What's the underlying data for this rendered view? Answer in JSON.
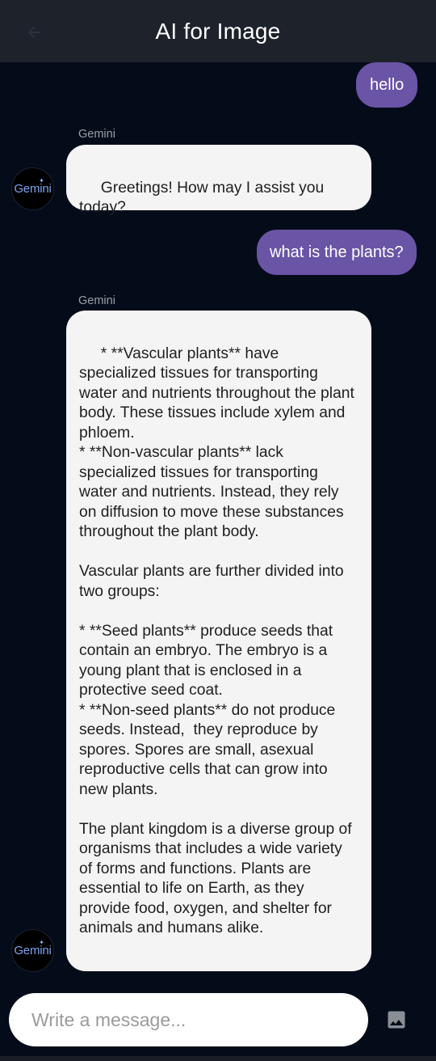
{
  "app": {
    "title": "AI for Image",
    "back_icon": "arrow-back-icon"
  },
  "messages": [
    {
      "role": "user",
      "text": "hello"
    },
    {
      "role": "ai",
      "sender": "Gemini",
      "avatar_label": "Gemini",
      "text": " Greetings! How may I assist you today?"
    },
    {
      "role": "user",
      "text": "what is the plants?"
    },
    {
      "role": "ai",
      "sender": "Gemini",
      "avatar_label": "Gemini",
      "text": " * **Vascular plants** have specialized tissues for transporting water and nutrients throughout the plant  body. These tissues include xylem and phloem.\n* **Non-vascular plants** lack specialized tissues for transporting water and nutrients. Instead, they rely  on diffusion to move these substances throughout the plant body.\n\nVascular plants are further divided into two groups:\n\n* **Seed plants** produce seeds that contain an embryo. The embryo is a young plant that is enclosed in a protective seed coat.\n* **Non-seed plants** do not produce seeds. Instead,  they reproduce by spores. Spores are small, asexual reproductive cells that can grow into new plants.\n\nThe plant kingdom is a diverse group of organisms that includes a wide variety of forms and functions. Plants are essential to life on Earth, as they provide food, oxygen, and shelter for animals and humans alike."
    }
  ],
  "composer": {
    "placeholder": "Write a message...",
    "image_icon": "image-icon"
  },
  "colors": {
    "background": "#050c19",
    "appbar": "#1e222b",
    "user_bubble": "#6a54a6",
    "ai_bubble": "#f4f4f4"
  }
}
